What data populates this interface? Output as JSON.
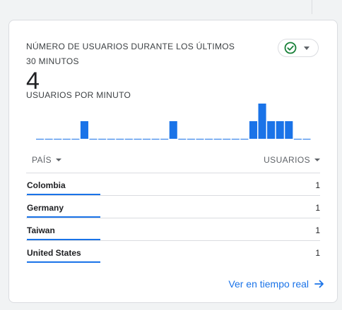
{
  "card": {
    "title": "NÚMERO DE USUARIOS DURANTE LOS ÚLTIMOS 30 MINUTOS",
    "active_users": "4",
    "subtitle": "USUARIOS POR MINUTO",
    "status_icon": "check-circle-icon",
    "accent_color": "#1a73e8",
    "status_color": "#188038"
  },
  "chart_data": {
    "type": "bar",
    "title": "",
    "ylabel": "",
    "xlabel": "",
    "values": [
      0,
      0,
      0,
      0,
      0,
      1,
      0,
      0,
      0,
      0,
      0,
      0,
      0,
      0,
      0,
      1,
      0,
      0,
      0,
      0,
      0,
      0,
      0,
      0,
      1,
      2,
      1,
      1,
      1,
      0,
      0
    ],
    "ylim": [
      0,
      2
    ]
  },
  "table": {
    "col_country": "PAÍS",
    "col_users": "USUARIOS",
    "rows": [
      {
        "country": "Colombia",
        "users": "1",
        "share": 1.0
      },
      {
        "country": "Germany",
        "users": "1",
        "share": 1.0
      },
      {
        "country": "Taiwan",
        "users": "1",
        "share": 1.0
      },
      {
        "country": "United States",
        "users": "1",
        "share": 1.0
      }
    ]
  },
  "footer": {
    "link_label": "Ver en tiempo real",
    "link_icon": "arrow-right-icon"
  }
}
